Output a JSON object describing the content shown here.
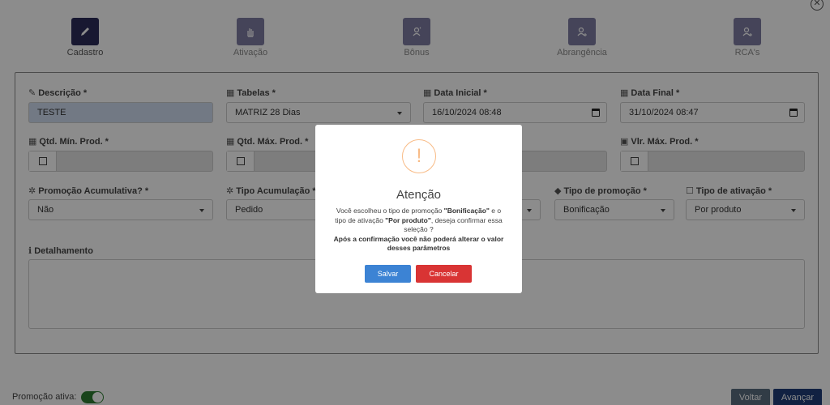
{
  "steps": [
    {
      "label": "Cadastro",
      "icon": "pencil-icon"
    },
    {
      "label": "Ativação",
      "icon": "hand-icon"
    },
    {
      "label": "Bônus",
      "icon": "user-star-icon"
    },
    {
      "label": "Abrangência",
      "icon": "user-plus-icon"
    },
    {
      "label": "RCA's",
      "icon": "user-plus-icon"
    }
  ],
  "form": {
    "descricao": {
      "label": "Descrição *",
      "value": "TESTE"
    },
    "tabelas": {
      "label": "Tabelas *",
      "value": "MATRIZ 28 Dias"
    },
    "data_inicial": {
      "label": "Data Inicial *",
      "value": "16/10/2024 08:48"
    },
    "data_final": {
      "label": "Data Final *",
      "value": "31/10/2024 08:47"
    },
    "qtd_min": {
      "label": "Qtd. Mín. Prod. *"
    },
    "qtd_max": {
      "label": "Qtd. Máx. Prod. *"
    },
    "vlr_max": {
      "label": "Vlr. Máx. Prod. *"
    },
    "promo_acumulativa": {
      "label": "Promoção Acumulativa? *",
      "value": "Não"
    },
    "tipo_acumulacao": {
      "label": "Tipo Acumulação *",
      "value": "Pedido"
    },
    "tipo_promocao": {
      "label": "Tipo de promoção *",
      "value": "Bonificação"
    },
    "tipo_ativacao": {
      "label": "Tipo de ativação *",
      "value": "Por produto"
    },
    "detalhamento": {
      "label": "Detalhamento"
    }
  },
  "footer": {
    "promo_ativa_label": "Promoção ativa:",
    "voltar": "Voltar",
    "avancar": "Avançar"
  },
  "modal": {
    "icon": "!",
    "title": "Atenção",
    "msg_part1": "Você escolheu o tipo de promoção ",
    "msg_bold1": "\"Bonificação\"",
    "msg_part2": " e o tipo de ativação ",
    "msg_bold2": "\"Por produto\"",
    "msg_part3": ", deseja confirmar essa seleção ?",
    "msg_bold3": "Após a confirmação você não poderá alterar o valor desses parâmetros",
    "salvar": "Salvar",
    "cancelar": "Cancelar"
  },
  "colors": {
    "active_step": "#2c2c5a",
    "inactive_step": "#7e7ca3",
    "warning": "#f8bb86",
    "save": "#3c83d4",
    "cancel": "#d93434"
  }
}
